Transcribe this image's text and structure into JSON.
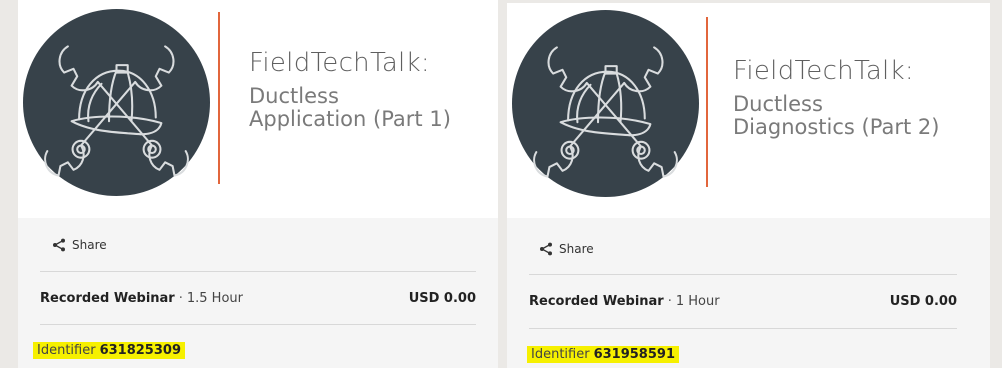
{
  "cards": [
    {
      "title_line1": "FieldTechTalk:",
      "title_line2": "Ductless",
      "title_line3": "Application (Part 1)",
      "share_label": "Share",
      "type": "Recorded Webinar",
      "separator": "·",
      "duration": "1.5 Hour",
      "price": "USD 0.00",
      "identifier_label": "Identifier",
      "identifier_value": "631825309"
    },
    {
      "title_line1": "FieldTechTalk:",
      "title_line2": "Ductless",
      "title_line3": "Diagnostics (Part 2)",
      "share_label": "Share",
      "type": "Recorded Webinar",
      "separator": "·",
      "duration": "1 Hour",
      "price": "USD 0.00",
      "identifier_label": "Identifier",
      "identifier_value": "631958591"
    }
  ],
  "colors": {
    "logo_bg": "#37424a",
    "accent_line": "#e2663c",
    "highlight": "#f6f000"
  },
  "icons": {
    "logo": "crossed-wrenches-hardhat-icon",
    "share": "share-icon"
  }
}
